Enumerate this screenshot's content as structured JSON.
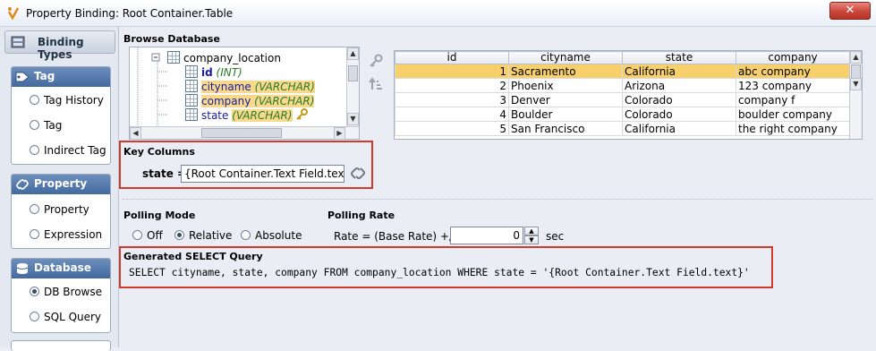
{
  "window": {
    "title": "Property Binding: Root Container.Table",
    "close_glyph": "✕"
  },
  "left_panel": {
    "header": "Binding Types",
    "groups": [
      {
        "label": "Tag",
        "icon": "tag-icon",
        "options": [
          "Tag History",
          "Tag",
          "Indirect Tag"
        ]
      },
      {
        "label": "Property",
        "icon": "link-icon",
        "options": [
          "Property",
          "Expression"
        ]
      },
      {
        "label": "Database",
        "icon": "database-icon",
        "options": [
          "DB Browse",
          "SQL Query"
        ]
      }
    ],
    "selected": "DB Browse"
  },
  "browse": {
    "label": "Browse Database",
    "tree": {
      "table": "company_location",
      "columns": [
        {
          "name": "id",
          "type": "(INT)",
          "highlighted": false,
          "key": false
        },
        {
          "name": "cityname",
          "type": "(VARCHAR)",
          "highlighted": true,
          "key": false
        },
        {
          "name": "company",
          "type": "(VARCHAR)",
          "highlighted": true,
          "key": false
        },
        {
          "name": "state",
          "type": "(VARCHAR)",
          "highlighted": true,
          "key": true
        }
      ]
    },
    "grid": {
      "headers": [
        "id",
        "cityname",
        "state",
        "company"
      ],
      "rows": [
        [
          "1",
          "Sacramento",
          "California",
          "abc company"
        ],
        [
          "2",
          "Phoenix",
          "Arizona",
          "123 company"
        ],
        [
          "3",
          "Denver",
          "Colorado",
          "company f"
        ],
        [
          "4",
          "Boulder",
          "Colorado",
          "boulder company"
        ],
        [
          "5",
          "San Francisco",
          "California",
          "the right company"
        ]
      ],
      "selected_row": 0
    }
  },
  "key_columns": {
    "label": "Key Columns",
    "field": "state =",
    "value": "{Root Container.Text Field.text}"
  },
  "polling": {
    "mode_label": "Polling Mode",
    "modes": [
      "Off",
      "Relative",
      "Absolute"
    ],
    "selected_mode": "Relative",
    "rate_label": "Polling Rate",
    "rate_prefix": "Rate = (Base Rate) +/-",
    "rate_value": "0",
    "rate_unit": "sec"
  },
  "query": {
    "label": "Generated SELECT Query",
    "text": "SELECT cityname, state, company FROM company_location WHERE state = '{Root Container.Text Field.text}'"
  }
}
